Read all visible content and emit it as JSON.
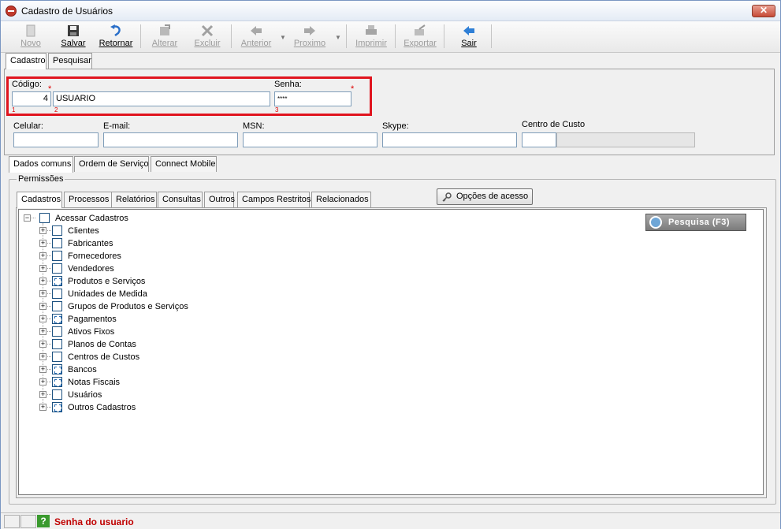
{
  "window": {
    "title": "Cadastro de Usuários",
    "close_label": "✕"
  },
  "toolbar": {
    "novo": "Novo",
    "salvar": "Salvar",
    "retornar": "Retornar",
    "alterar": "Alterar",
    "excluir": "Excluir",
    "anterior": "Anterior",
    "proximo": "Proximo",
    "imprimir": "Imprimir",
    "exportar": "Exportar",
    "sair": "Sair"
  },
  "form_tabs": [
    "Cadastro",
    "Pesquisar"
  ],
  "fields": {
    "codigo_label": "Código:",
    "codigo_value": "4",
    "nome_value": "USUARIO",
    "senha_label": "Senha:",
    "senha_value": "****",
    "celular_label": "Celular:",
    "email_label": "E-mail:",
    "msn_label": "MSN:",
    "skype_label": "Skype:",
    "centro_custo_label": "Centro de Custo",
    "required_mark": "*",
    "idx1": "1",
    "idx2": "2",
    "idx3": "3"
  },
  "section_tabs": [
    "Dados comuns",
    "Ordem de Serviço",
    "Connect Mobile"
  ],
  "permissions": {
    "legend": "Permissões",
    "tabs": [
      "Cadastros",
      "Processos",
      "Relatórios",
      "Consultas",
      "Outros",
      "Campos Restritos",
      "Relacionados"
    ],
    "access_button": "Opções de acesso",
    "search_button": "Pesquisa (F3)",
    "root": "Acessar Cadastros",
    "items": [
      {
        "label": "Clientes",
        "partial": false
      },
      {
        "label": "Fabricantes",
        "partial": false
      },
      {
        "label": "Fornecedores",
        "partial": false
      },
      {
        "label": "Vendedores",
        "partial": false
      },
      {
        "label": "Produtos e Serviços",
        "partial": true
      },
      {
        "label": "Unidades de Medida",
        "partial": false
      },
      {
        "label": "Grupos de Produtos e Serviços",
        "partial": false
      },
      {
        "label": "Pagamentos",
        "partial": true
      },
      {
        "label": "Ativos Fixos",
        "partial": false
      },
      {
        "label": "Planos de Contas",
        "partial": false
      },
      {
        "label": "Centros de Custos",
        "partial": false
      },
      {
        "label": "Bancos",
        "partial": true
      },
      {
        "label": "Notas Fiscais",
        "partial": true
      },
      {
        "label": "Usuários",
        "partial": false
      },
      {
        "label": "Outros Cadastros",
        "partial": true
      }
    ]
  },
  "status": {
    "help_icon": "?",
    "message": "Senha do usuario"
  }
}
